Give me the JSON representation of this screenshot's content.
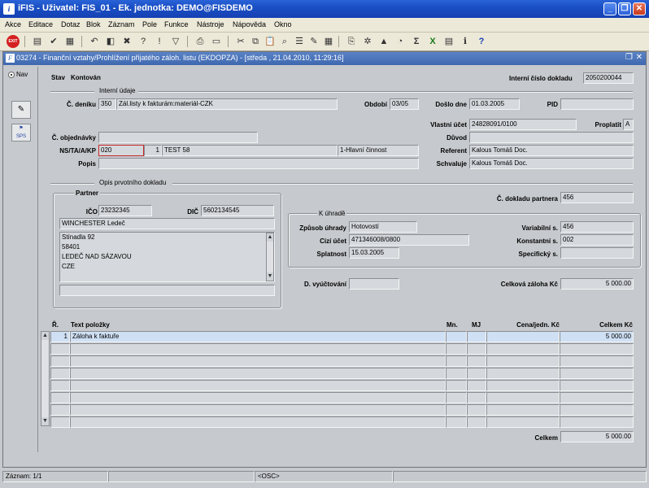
{
  "window": {
    "title": "iFIS - Uživatel: FIS_01 - Ek. jednotka: DEMO@FISDEMO",
    "minimize_glyph": "_",
    "restore_glyph": "❐",
    "close_glyph": "✕"
  },
  "menu": [
    "Akce",
    "Editace",
    "Dotaz",
    "Blok",
    "Záznam",
    "Pole",
    "Funkce",
    "Nástroje",
    "Nápověda",
    "Okno"
  ],
  "toolbar": {
    "exit_label": "EXIT",
    "icons": [
      "save-icon",
      "undo-icon",
      "clear-icon",
      "print-icon",
      "cut-icon",
      "copy-icon",
      "paste-icon",
      "sum-icon",
      "excel-icon",
      "help-icon"
    ]
  },
  "doc_window": {
    "title": "03274 - Finanční vztahy/Prohlížení přijatého záloh. listu (EKDOPZA) - [středa , 21.04.2010, 11:29:16]"
  },
  "nav": {
    "label": "Nav",
    "sps_label": "SPS"
  },
  "header": {
    "stav_label": "Stav",
    "stav_value": "Kontován",
    "interni_cislo_label": "Interní číslo dokladu",
    "interni_cislo_value": "2050200044"
  },
  "interni_udaje": {
    "section_label": "Interní údaje",
    "c_deniku_label": "Č. deníku",
    "c_deniku_value": "350",
    "c_deniku_desc": "Zál.listy k fakturám:materiál-CZK",
    "obdobi_label": "Období",
    "obdobi_value": "03/05",
    "doslo_dne_label": "Došlo dne",
    "doslo_dne_value": "01.03.2005",
    "pid_label": "PID",
    "pid_value": "",
    "vlastni_ucet_label": "Vlastní účet",
    "vlastni_ucet_value": "24828091/0100",
    "proplatit_label": "Proplatit",
    "proplatit_value": "A",
    "c_objednavky_label": "Č. objednávky",
    "c_objednavky_value": "",
    "duvod_label": "Důvod",
    "duvod_value": "",
    "ns_label": "NS/TA/A/KP",
    "ns_value": "020",
    "ta_value": "1",
    "a_value": "TEST 58",
    "kp_value": "1-Hlavní činnost",
    "referent_label": "Referent",
    "referent_value": "Kalous Tomáš Doc.",
    "popis_label": "Popis",
    "popis_value": "",
    "schvaluje_label": "Schvaluje",
    "schvaluje_value": "Kalous Tomáš Doc."
  },
  "opis": {
    "section_label": "Opis prvotního dokladu",
    "partner_label": "Partner",
    "ico_label": "IČO",
    "ico_value": "23232345",
    "dic_label": "DIČ",
    "dic_value": "5602134545",
    "partner_name": "WINCHESTER Ledeč",
    "address_lines": [
      "Stínadla 92",
      "58401",
      "LEDEČ NAD SÁZAVOU",
      "CZE"
    ],
    "c_dokladu_partnera_label": "Č. dokladu partnera",
    "c_dokladu_partnera_value": "456"
  },
  "k_uhrade": {
    "section_label": "K úhradě",
    "zpusob_label": "Způsob úhrady",
    "zpusob_value": "Hotovostí",
    "cizi_ucet_label": "Cizí účet",
    "cizi_ucet_value": "471346008/0800",
    "splatnost_label": "Splatnost",
    "splatnost_value": "15.03.2005",
    "variabilni_label": "Variabilní s.",
    "variabilni_value": "456",
    "konstantni_label": "Konstantní s.",
    "konstantni_value": "002",
    "specificky_label": "Specifický s.",
    "specificky_value": ""
  },
  "d_vyuctovani_label": "D. vyúčtování",
  "d_vyuctovani_value": "",
  "celkova_zaloha_label": "Celková záloha Kč",
  "celkova_zaloha_value": "5 000.00",
  "items_table": {
    "columns": [
      "Ř.",
      "Text položky",
      "Mn.",
      "MJ",
      "Cena/jedn. Kč",
      "Celkem Kč"
    ],
    "rows": [
      [
        "1",
        "Záloha k faktuře",
        "",
        "",
        "",
        "5 000.00"
      ],
      [
        "",
        "",
        "",
        "",
        "",
        ""
      ],
      [
        "",
        "",
        "",
        "",
        "",
        ""
      ],
      [
        "",
        "",
        "",
        "",
        "",
        ""
      ],
      [
        "",
        "",
        "",
        "",
        "",
        ""
      ],
      [
        "",
        "",
        "",
        "",
        "",
        ""
      ],
      [
        "",
        "",
        "",
        "",
        "",
        ""
      ],
      [
        "",
        "",
        "",
        "",
        "",
        ""
      ]
    ]
  },
  "celkem_label": "Celkem",
  "celkem_value": "5 000.00",
  "status": {
    "zaznam": "Záznam: 1/1",
    "mode": "<OSC>"
  }
}
